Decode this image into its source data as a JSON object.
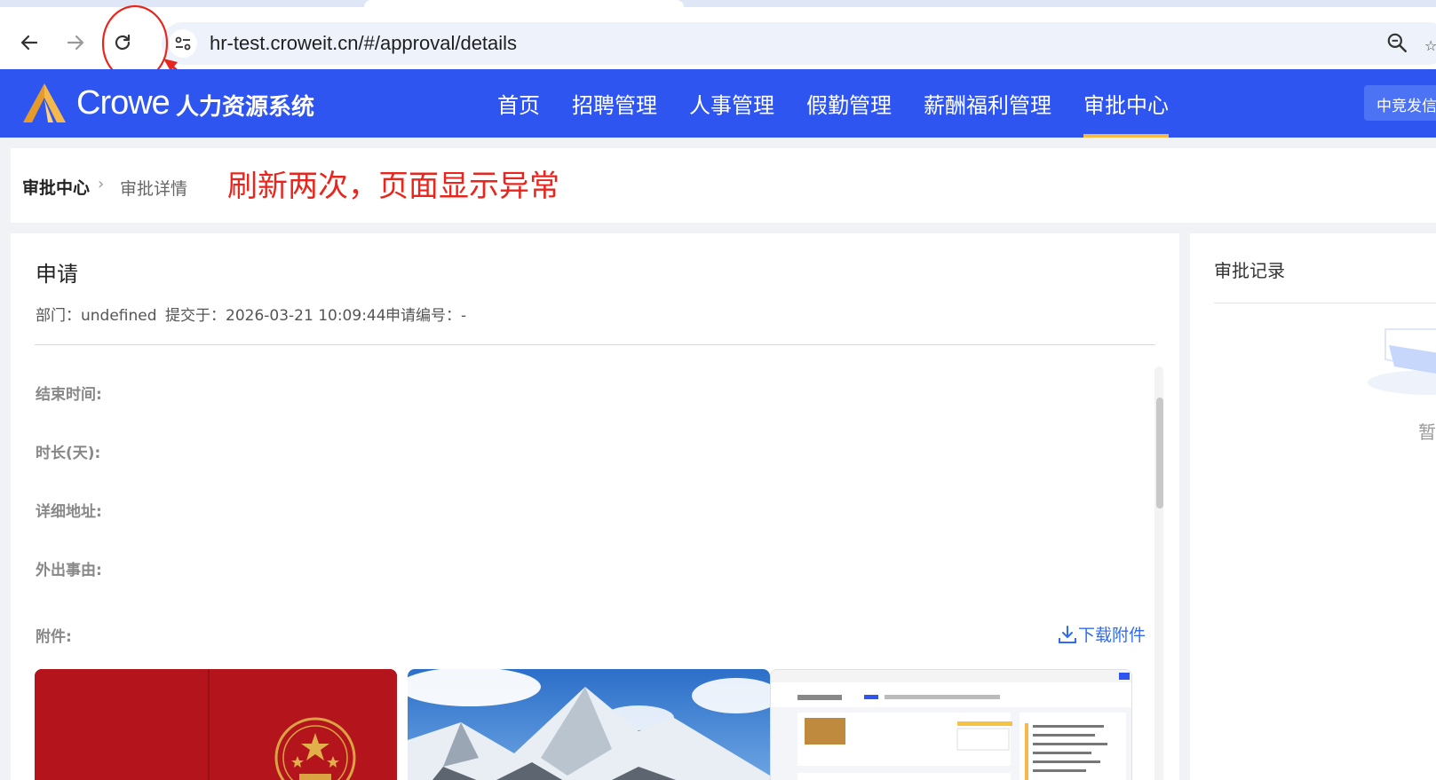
{
  "browser": {
    "url": "hr-test.croweit.cn/#/approval/details"
  },
  "header": {
    "logo_text": "Crowe",
    "system_name": "人力资源系统",
    "nav": [
      "首页",
      "招聘管理",
      "人事管理",
      "假勤管理",
      "薪酬福利管理",
      "审批中心"
    ],
    "active_nav": "审批中心",
    "company_button": "中竞发信",
    "colors": {
      "brand": "#2f55f0",
      "active_underline": "#f5b94a"
    }
  },
  "breadcrumb": {
    "root": "审批中心",
    "current": "审批详情"
  },
  "annotation": {
    "text": "刷新两次，页面显示异常",
    "color": "#e8261e"
  },
  "request": {
    "title": "申请",
    "department": "部门：undefined",
    "submitted": "提交于：2026-03-21 10:09:44",
    "request_no": "申请编号：-",
    "fields": [
      "结束时间:",
      "时长(天):",
      "详细地址:",
      "外出事由:"
    ],
    "attachments_label": "附件:",
    "download_label": "下载附件"
  },
  "sidebar": {
    "title": "审批记录",
    "empty_text": "暂"
  }
}
